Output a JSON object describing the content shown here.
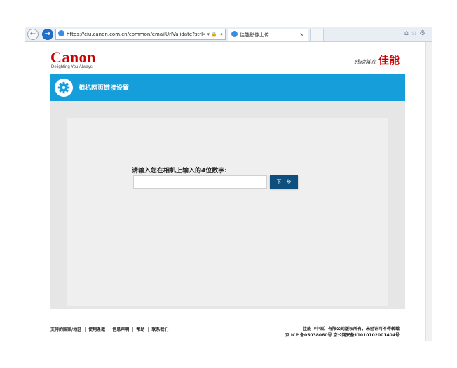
{
  "browser": {
    "url": "https://ciu.canon.com.cn/common/emailUrlValidate?strI",
    "addr_tools": "⌕ ▾ 🔒 →",
    "tab_title": "佳能影像上传",
    "tab_close": "×",
    "chrome_icons": "⌂☆⚙",
    "back_label": "←",
    "forward_label": "→"
  },
  "header": {
    "logo": "Canon",
    "tagline": "Delighting You Always",
    "slogan": "感动常在",
    "brand_cn": "佳能"
  },
  "banner": {
    "title": "相机网页链接设置"
  },
  "form": {
    "prompt": "请输入您在相机上输入的4位数字:",
    "input_value": "",
    "next_label": "下一步"
  },
  "footer": {
    "links": [
      "支持的国家/地区",
      "使用条款",
      "信息声明",
      "帮助",
      "联系我们"
    ],
    "separator": "|",
    "copyright": "佳能（中国）有限公司版权所有，未经许可不得转载",
    "icp": "京 ICP 备05038060号 京公网安备11010102001404号"
  },
  "colors": {
    "brand_red": "#cc0000",
    "banner_blue": "#159ed9",
    "button_navy": "#0f4f7d"
  },
  "icons": {
    "banner_icon": "gear-icon",
    "back": "back-arrow-icon",
    "forward": "forward-arrow-icon"
  }
}
